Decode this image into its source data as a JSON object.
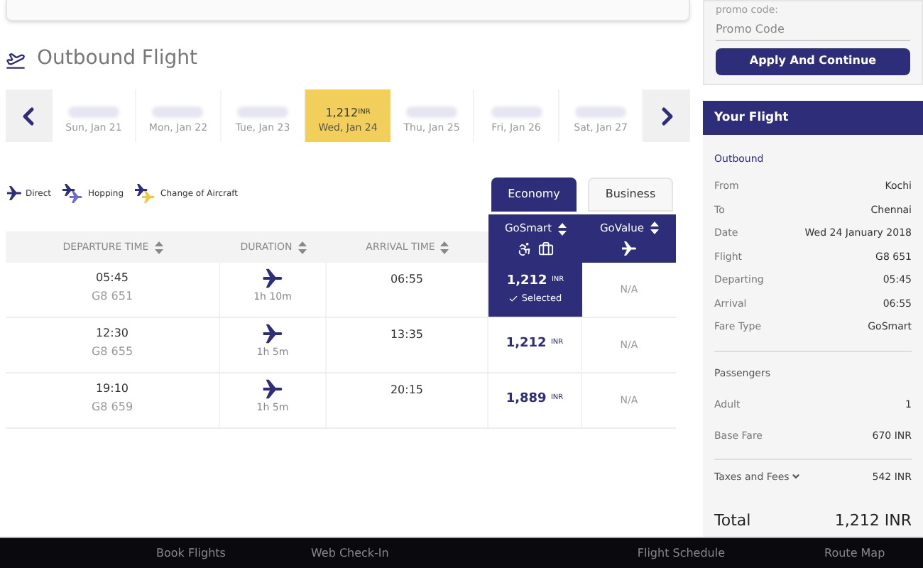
{
  "main": {
    "title": "Outbound Flight",
    "dates": [
      {
        "label": "Sun, Jan 21",
        "selected": false
      },
      {
        "label": "Mon, Jan 22",
        "selected": false
      },
      {
        "label": "Tue, Jan 23",
        "selected": false
      },
      {
        "label": "Wed, Jan 24",
        "price": "1,212",
        "currency": "INR",
        "selected": true
      },
      {
        "label": "Thu, Jan 25",
        "selected": false
      },
      {
        "label": "Fri, Jan 26",
        "selected": false
      },
      {
        "label": "Sat, Jan 27",
        "selected": false
      }
    ],
    "legend": [
      {
        "kind": "direct",
        "label": "Direct"
      },
      {
        "kind": "hopping",
        "label": "Hopping"
      },
      {
        "kind": "change",
        "label": "Change of Aircraft"
      }
    ],
    "cabin_tabs": [
      {
        "label": "Economy",
        "selected": true
      },
      {
        "label": "Business",
        "selected": false
      }
    ],
    "table": {
      "columns": [
        "DEPARTURE TIME",
        "DURATION",
        "ARRIVAL TIME"
      ],
      "fare_columns": [
        {
          "label": "GoSmart",
          "kind": "gosmart"
        },
        {
          "label": "GoValue",
          "kind": "govalue"
        }
      ],
      "rows": [
        {
          "departure": "05:45",
          "flight": "G8 651",
          "duration": "1h 10m",
          "arrival": "06:55",
          "price": "1,212",
          "currency": "INR",
          "selected": true,
          "selected_label": "Selected",
          "other": "N/A"
        },
        {
          "departure": "12:30",
          "flight": "G8 655",
          "duration": "1h 5m",
          "arrival": "13:35",
          "price": "1,212",
          "currency": "INR",
          "selected": false,
          "other": "N/A"
        },
        {
          "departure": "19:10",
          "flight": "G8 659",
          "duration": "1h 5m",
          "arrival": "20:15",
          "price": "1,889",
          "currency": "INR",
          "selected": false,
          "other": "N/A"
        }
      ]
    }
  },
  "sidebar": {
    "promo_note": "promo code:",
    "promo_placeholder": "Promo Code",
    "apply_button": "Apply And Continue",
    "your_flight": {
      "title": "Your Flight",
      "section": "Outbound",
      "details": [
        {
          "label": "From",
          "value": "Kochi"
        },
        {
          "label": "To",
          "value": "Chennai"
        },
        {
          "label": "Date",
          "value": "Wed 24 January 2018"
        },
        {
          "label": "Flight",
          "value": "G8 651"
        },
        {
          "label": "Departing",
          "value": "05:45"
        },
        {
          "label": "Arrival",
          "value": "06:55"
        },
        {
          "label": "Fare Type",
          "value": "GoSmart"
        }
      ],
      "passengers_title": "Passengers",
      "fares": [
        {
          "label": "Adult",
          "value": "1"
        },
        {
          "label": "Base Fare",
          "value": "670 INR"
        }
      ],
      "taxes": {
        "label": "Taxes and Fees",
        "value": "542 INR",
        "expanded": false
      },
      "total": {
        "label": "Total",
        "value": "1,212 INR"
      }
    }
  },
  "footer": [
    "Book Flights",
    "Web Check-In",
    "Flight Schedule",
    "Route Map"
  ]
}
